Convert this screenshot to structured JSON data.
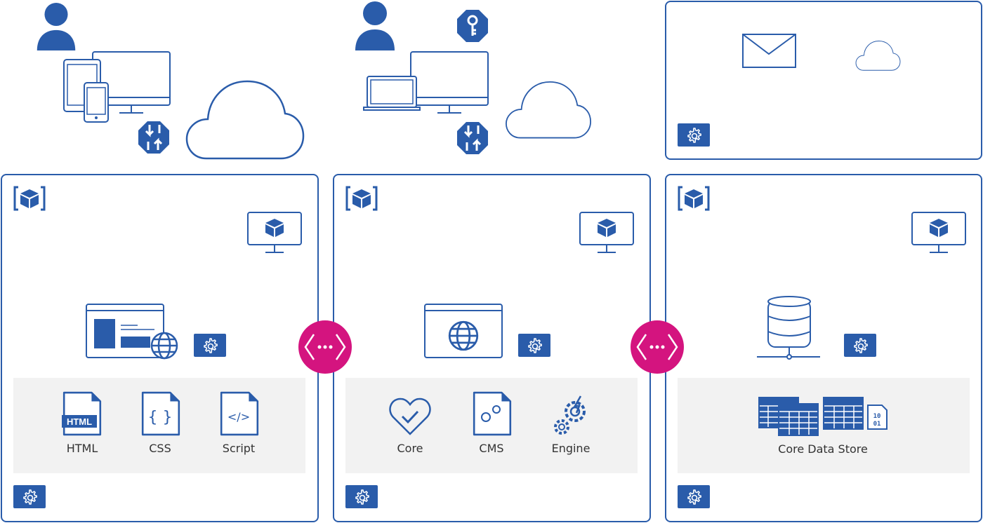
{
  "colors": {
    "primary": "#2a5caa",
    "connector": "#d4147f",
    "panel": "#f2f2f2"
  },
  "tiers": [
    {
      "items": [
        {
          "label": "HTML",
          "icon": "html-file-icon",
          "badge": "HTML"
        },
        {
          "label": "CSS",
          "icon": "css-file-icon"
        },
        {
          "label": "Script",
          "icon": "script-file-icon"
        }
      ]
    },
    {
      "items": [
        {
          "label": "Core",
          "icon": "heart-check-icon"
        },
        {
          "label": "CMS",
          "icon": "cms-file-icon"
        },
        {
          "label": "Engine",
          "icon": "engine-gears-icon"
        }
      ]
    },
    {
      "items": [
        {
          "label": "Core Data Store",
          "icon": "data-tables-icon",
          "binary": "10 01"
        }
      ]
    }
  ]
}
